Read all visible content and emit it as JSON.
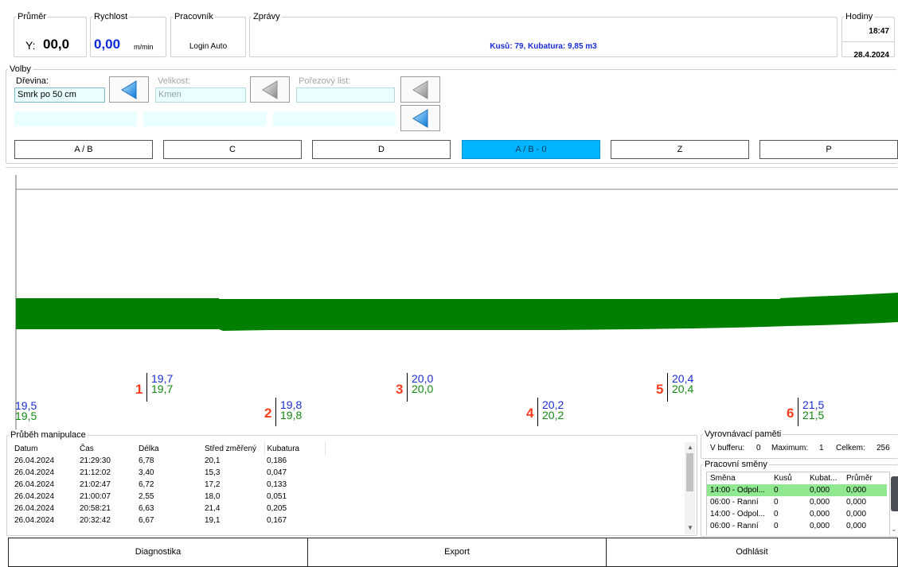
{
  "header": {
    "prumer": {
      "legend": "Průměr",
      "prefix": "Y:",
      "value": "00,0"
    },
    "rychlost": {
      "legend": "Rychlost",
      "value": "0,00",
      "unit": "m/min"
    },
    "pracovnik": {
      "legend": "Pracovník",
      "value": "Login Auto"
    },
    "zpravy": {
      "legend": "Zprávy",
      "message": "Kusů: 79, Kubatura: 9,85 m3"
    },
    "hodiny": {
      "legend": "Hodiny",
      "time": "18:47",
      "date": "28.4.2024"
    }
  },
  "volby": {
    "legend": "Volby",
    "drevina_label": "Dřevina:",
    "drevina_value": "Smrk po 50 cm",
    "velikost_label": "Velikost:",
    "velikost_value": "Kmen",
    "porezovy_label": "Pořezový list:",
    "porezovy_value": ""
  },
  "tabs": [
    {
      "label": "A / B",
      "active": false
    },
    {
      "label": "C",
      "active": false
    },
    {
      "label": "D",
      "active": false
    },
    {
      "label": "A / B - 0",
      "active": true
    },
    {
      "label": "Z",
      "active": false
    },
    {
      "label": "P",
      "active": false
    }
  ],
  "measurements": [
    {
      "number": "",
      "blue": "19,5",
      "green": "19,5"
    },
    {
      "number": "1",
      "blue": "19,7",
      "green": "19,7"
    },
    {
      "number": "2",
      "blue": "19,8",
      "green": "19,8"
    },
    {
      "number": "3",
      "blue": "20,0",
      "green": "20,0"
    },
    {
      "number": "4",
      "blue": "20,2",
      "green": "20,2"
    },
    {
      "number": "5",
      "blue": "20,4",
      "green": "20,4"
    },
    {
      "number": "6",
      "blue": "21,5",
      "green": "21,5"
    }
  ],
  "manipulace": {
    "legend": "Průběh manipulace",
    "columns": [
      "Datum",
      "Čas",
      "Délka",
      "Střed změřený",
      "Kubatura"
    ],
    "rows": [
      [
        "26.04.2024",
        "21:29:30",
        "6,78",
        "20,1",
        "0,186"
      ],
      [
        "26.04.2024",
        "21:12:02",
        "3,40",
        "15,3",
        "0,047"
      ],
      [
        "26.04.2024",
        "21:02:47",
        "6,72",
        "17,2",
        "0,133"
      ],
      [
        "26.04.2024",
        "21:00:07",
        "2,55",
        "18,0",
        "0,051"
      ],
      [
        "26.04.2024",
        "20:58:21",
        "6,63",
        "21,4",
        "0,205"
      ],
      [
        "26.04.2024",
        "20:32:42",
        "6,67",
        "19,1",
        "0,167"
      ]
    ]
  },
  "buffer": {
    "legend": "Vyrovnávací paměti",
    "v_bufferu_label": "V bufferu:",
    "v_bufferu": "0",
    "maximum_label": "Maximum:",
    "maximum": "1",
    "celkem_label": "Celkem:",
    "celkem": "256"
  },
  "smeny": {
    "legend": "Pracovní směny",
    "columns": [
      "Směna",
      "Kusů",
      "Kubat...",
      "Průměr"
    ],
    "rows": [
      [
        "14:00 - Odpol...",
        "0",
        "0,000",
        "0,000"
      ],
      [
        "06:00 - Ranní",
        "0",
        "0,000",
        "0,000"
      ],
      [
        "14:00 - Odpol...",
        "0",
        "0,000",
        "0,000"
      ],
      [
        "06:00 - Ranní",
        "0",
        "0,000",
        "0,000"
      ]
    ]
  },
  "bottom": {
    "diagnostika": "Diagnostika",
    "export": "Export",
    "odhlasit": "Odhlásit"
  },
  "colors": {
    "log_fill": "#008000",
    "active_tab": "#00b4ff",
    "message_blue": "#1a2cd6",
    "value_blue": "#0a28d8",
    "marker_red": "#ff3c1e",
    "selected_row": "#90e890"
  }
}
